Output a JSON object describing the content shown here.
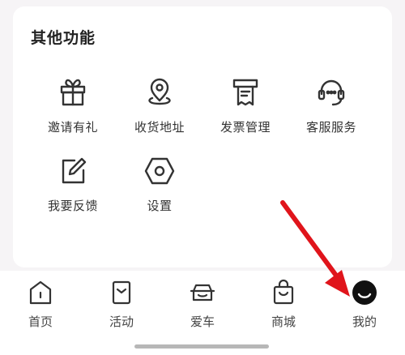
{
  "section": {
    "title": "其他功能"
  },
  "functions": [
    {
      "label": "邀请有礼",
      "icon": "gift-icon"
    },
    {
      "label": "收货地址",
      "icon": "location-pin-icon"
    },
    {
      "label": "发票管理",
      "icon": "invoice-icon"
    },
    {
      "label": "客服服务",
      "icon": "headset-icon"
    },
    {
      "label": "我要反馈",
      "icon": "edit-feedback-icon"
    },
    {
      "label": "设置",
      "icon": "settings-hex-icon"
    }
  ],
  "tabbar": [
    {
      "label": "首页",
      "icon": "home-icon"
    },
    {
      "label": "活动",
      "icon": "activity-bookmark-icon"
    },
    {
      "label": "爱车",
      "icon": "car-icon"
    },
    {
      "label": "商城",
      "icon": "shopping-bag-icon"
    },
    {
      "label": "我的",
      "icon": "profile-icon",
      "selected": true
    }
  ],
  "colors": {
    "annotation_arrow": "#e0141b",
    "icon_stroke": "#333333",
    "profile_icon": "#111111"
  }
}
